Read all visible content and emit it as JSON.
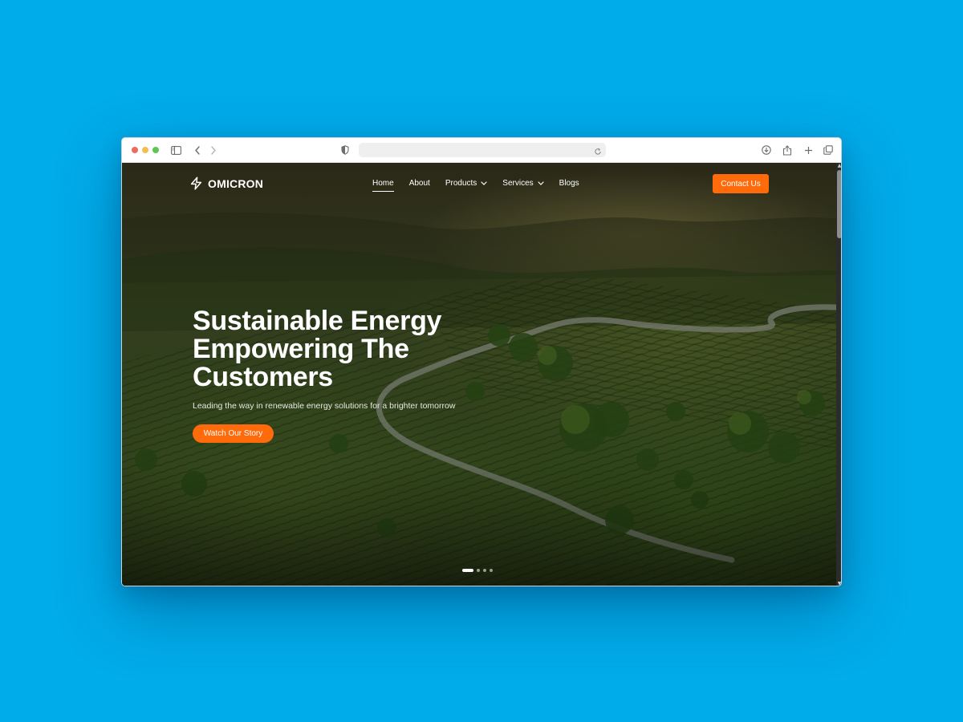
{
  "browser": {
    "traffic_lights": [
      {
        "name": "close",
        "color": "#EC6A5E"
      },
      {
        "name": "minimize",
        "color": "#F4BF4F"
      },
      {
        "name": "maximize",
        "color": "#61C554"
      }
    ],
    "url": "",
    "toolbar_icons": [
      "sidebar-icon",
      "back-icon",
      "forward-icon",
      "shield-icon",
      "reload-icon",
      "download-icon",
      "share-icon",
      "new-tab-icon",
      "tabs-overview-icon"
    ]
  },
  "site": {
    "logo_text": "OMICRON",
    "logo_icon": "lightning-bolt-icon",
    "nav": {
      "home": "Home",
      "about": "About",
      "products": "Products",
      "services": "Services",
      "blogs": "Blogs"
    },
    "active_nav": "Home",
    "contact_label": "Contact Us",
    "accent_color": "#FF6B0A"
  },
  "hero": {
    "title_line1": "Sustainable Energy",
    "title_line2": "Empowering The",
    "title_line3": "Customers",
    "subtitle": "Leading the way in renewable energy solutions for a brighter tomorrow",
    "cta_label": "Watch Our Story",
    "slides_total": 4,
    "active_slide": 1
  },
  "colors": {
    "desktop_background": "#00ACE9"
  }
}
